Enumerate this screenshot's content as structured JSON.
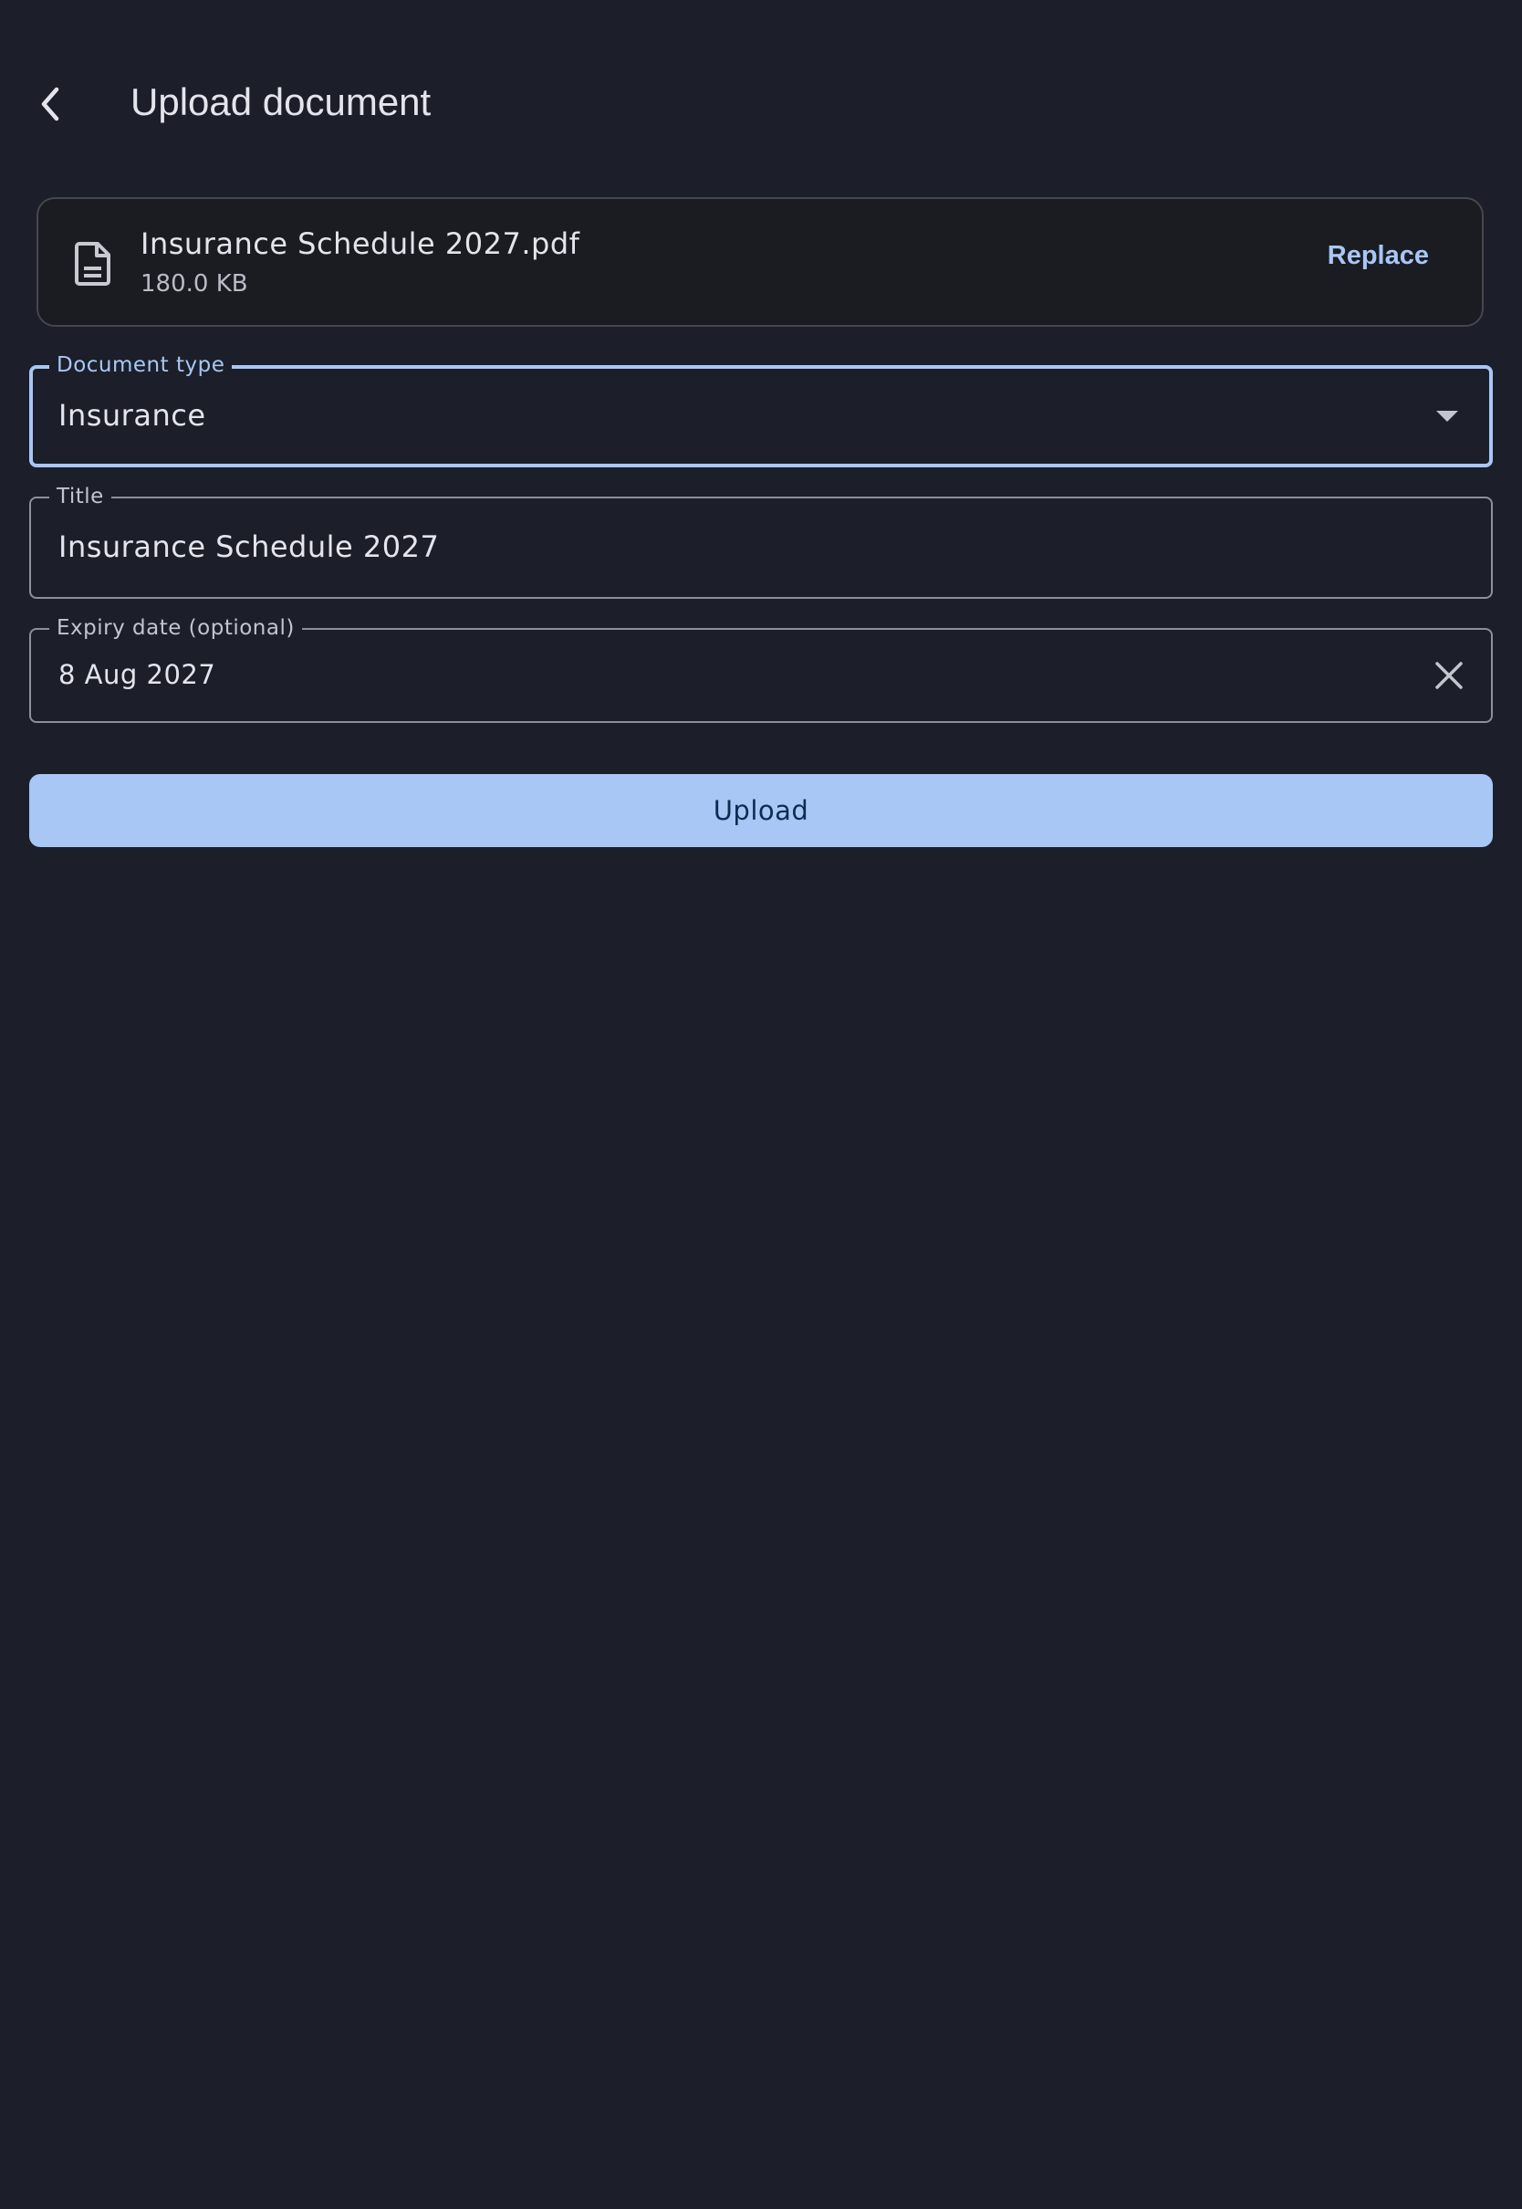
{
  "header": {
    "title": "Upload document",
    "back_icon": "chevron-left-icon"
  },
  "file": {
    "icon": "document-icon",
    "name": "Insurance Schedule 2027.pdf",
    "size": "180.0 KB",
    "replace_label": "Replace"
  },
  "form": {
    "document_type": {
      "label": "Document type",
      "value": "Insurance",
      "icon": "dropdown-arrow-icon"
    },
    "title": {
      "label": "Title",
      "value": "Insurance Schedule 2027"
    },
    "expiry": {
      "label": "Expiry date (optional)",
      "value": "8 Aug 2027",
      "icon": "close-icon"
    }
  },
  "upload_label": "Upload",
  "colors": {
    "background": "#1c1f29",
    "accent": "#a8c7f5",
    "card": "#1a1c22",
    "outline": "#8d9099",
    "text": "#e4e5ec",
    "button_text": "#0d2c52"
  }
}
